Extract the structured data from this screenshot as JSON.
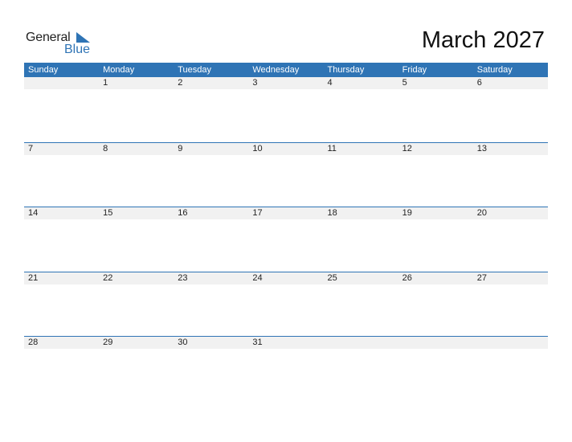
{
  "logo": {
    "general": "General",
    "blue": "Blue",
    "icon": "triangle-flag-icon"
  },
  "title": "March 2027",
  "colors": {
    "accent": "#2f74b5",
    "date_strip": "#f1f1f1"
  },
  "weekdays": [
    "Sunday",
    "Monday",
    "Tuesday",
    "Wednesday",
    "Thursday",
    "Friday",
    "Saturday"
  ],
  "weeks": [
    [
      "",
      "1",
      "2",
      "3",
      "4",
      "5",
      "6"
    ],
    [
      "7",
      "8",
      "9",
      "10",
      "11",
      "12",
      "13"
    ],
    [
      "14",
      "15",
      "16",
      "17",
      "18",
      "19",
      "20"
    ],
    [
      "21",
      "22",
      "23",
      "24",
      "25",
      "26",
      "27"
    ],
    [
      "28",
      "29",
      "30",
      "31",
      "",
      "",
      ""
    ]
  ]
}
